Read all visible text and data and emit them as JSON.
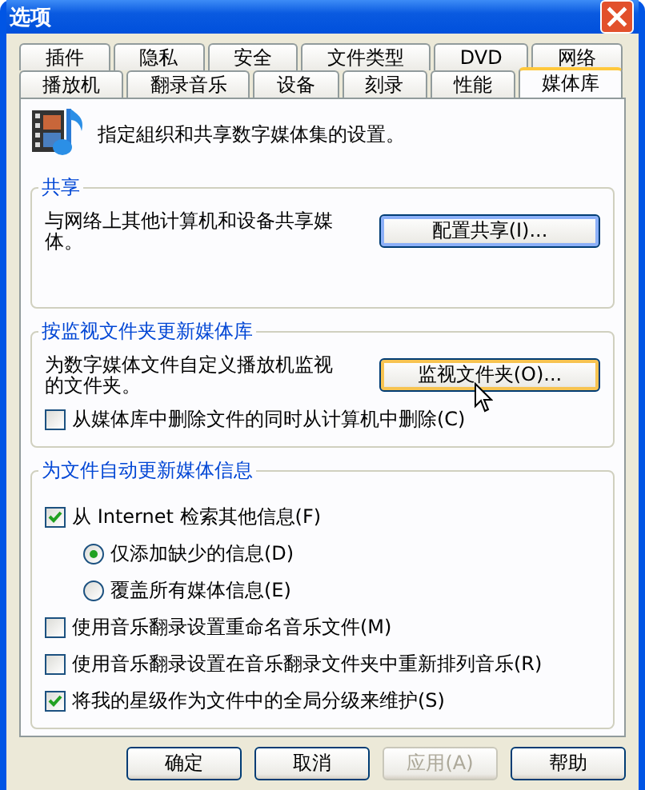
{
  "window": {
    "title": "选项"
  },
  "tab_rows": [
    [
      {
        "label": "插件",
        "selected": false
      },
      {
        "label": "隐私",
        "selected": false
      },
      {
        "label": "安全",
        "selected": false
      },
      {
        "label": "文件类型",
        "selected": false
      },
      {
        "label": "DVD",
        "selected": false
      },
      {
        "label": "网络",
        "selected": false
      }
    ],
    [
      {
        "label": "播放机",
        "selected": false
      },
      {
        "label": "翻录音乐",
        "selected": false
      },
      {
        "label": "设备",
        "selected": false
      },
      {
        "label": "刻录",
        "selected": false
      },
      {
        "label": "性能",
        "selected": false
      },
      {
        "label": "媒体库",
        "selected": true
      }
    ]
  ],
  "intro": "指定組织和共享数字媒体集的设置。",
  "groups": [
    {
      "title": "共享",
      "description": "与网络上其他计算机和设备共享媒体。",
      "button": {
        "label": "配置共享(I)...",
        "focused": true
      }
    },
    {
      "title": "按监视文件夹更新媒体库",
      "description": "为数字媒体文件自定义播放机监视的文件夹。",
      "button": {
        "label": "监视文件夹(O)...",
        "focused": false,
        "hovered": true
      },
      "items": [
        {
          "kind": "checkbox",
          "label": "从媒体库中删除文件的同时从计算机中删除(C)",
          "checked": false,
          "indented": false
        }
      ]
    },
    {
      "title": "为文件自动更新媒体信息",
      "items": [
        {
          "kind": "checkbox",
          "label": "从 Internet 检索其他信息(F)",
          "checked": true,
          "indented": false
        },
        {
          "kind": "radio",
          "label": "仅添加缺少的信息(D)",
          "selected": true,
          "indented": true
        },
        {
          "kind": "radio",
          "label": "覆盖所有媒体信息(E)",
          "selected": false,
          "indented": true
        },
        {
          "kind": "checkbox",
          "label": "使用音乐翻录设置重命名音乐文件(M)",
          "checked": false,
          "indented": false
        },
        {
          "kind": "checkbox",
          "label": "使用音乐翻录设置在音乐翻录文件夹中重新排列音乐(R)",
          "checked": false,
          "indented": false
        },
        {
          "kind": "checkbox",
          "label": "将我的星级作为文件中的全局分级来维护(S)",
          "checked": true,
          "indented": false
        }
      ]
    }
  ],
  "buttons": [
    {
      "label": "确定",
      "disabled": false
    },
    {
      "label": "取消",
      "disabled": false
    },
    {
      "label": "应用(A)",
      "disabled": true
    },
    {
      "label": "帮助",
      "disabled": false
    }
  ]
}
